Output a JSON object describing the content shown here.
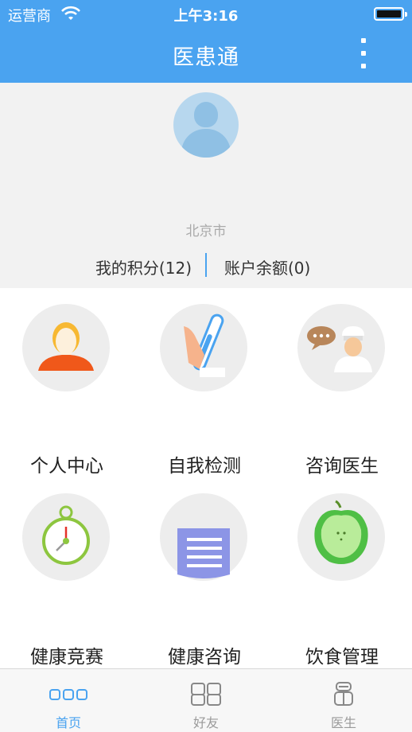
{
  "status": {
    "carrier": "运营商",
    "time": "上午3:16"
  },
  "header": {
    "title": "医患通"
  },
  "profile": {
    "city": "北京市",
    "points_label": "我的积分(12)",
    "balance_label": "账户余额(0)"
  },
  "menu": [
    {
      "label": "个人中心",
      "icon": "person-icon"
    },
    {
      "label": "自我检测",
      "icon": "thermometer-icon"
    },
    {
      "label": "咨询医生",
      "icon": "doctor-chat-icon"
    },
    {
      "label": "健康竞赛",
      "icon": "stopwatch-icon"
    },
    {
      "label": "健康咨询",
      "icon": "notepad-icon"
    },
    {
      "label": "饮食管理",
      "icon": "apple-icon"
    }
  ],
  "tabs": [
    {
      "label": "首页",
      "icon": "home-dots-icon",
      "active": true
    },
    {
      "label": "好友",
      "icon": "friends-icon",
      "active": false
    },
    {
      "label": "医生",
      "icon": "doctor-icon",
      "active": false
    }
  ],
  "colors": {
    "primary": "#4aa3f0",
    "background_gray": "#f2f2f2",
    "icon_circle": "#ededed"
  }
}
